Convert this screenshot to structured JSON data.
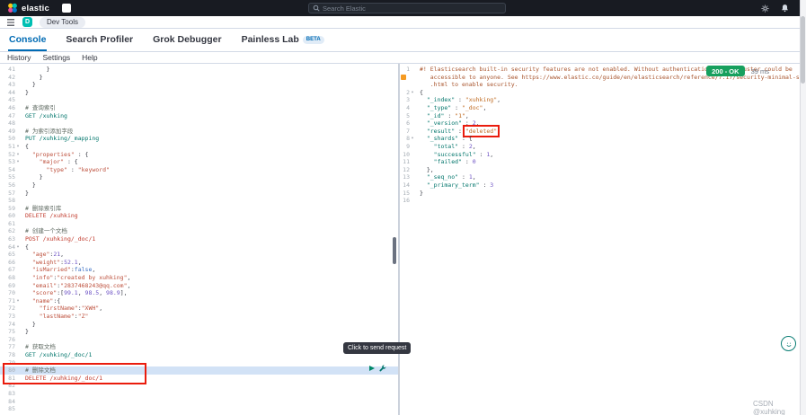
{
  "header": {
    "logo_text": "elastic",
    "search_placeholder": "Search Elastic",
    "right_icons": [
      "settings-icon",
      "notifications-icon"
    ]
  },
  "breadcrumb_bar": {
    "space_initial": "D",
    "breadcrumb": "Dev Tools"
  },
  "tabs": [
    {
      "label": "Console",
      "active": true
    },
    {
      "label": "Search Profiler",
      "active": false
    },
    {
      "label": "Grok Debugger",
      "active": false
    },
    {
      "label": "Painless Lab",
      "active": false,
      "badge": "BETA"
    }
  ],
  "console_toolbar": [
    "History",
    "Settings",
    "Help"
  ],
  "status": {
    "badge": "200 - OK",
    "time": "39 ms"
  },
  "tooltip": "Click to send request",
  "watermark": "CSDN @xuhking",
  "colors": {
    "header_bg": "#181b22",
    "accent_blue": "#006bb4",
    "success_badge": "#17a05e",
    "annotation_red": "#ea1c0d",
    "method_get_put": "#00756b",
    "method_post_delete": "#c0392b",
    "space_avatar": "#00bfb3",
    "warning_icon": "#f59b23"
  },
  "editor": {
    "active_line": 80,
    "lines": [
      {
        "n": 41,
        "s": [
          [
            "      }",
            "p"
          ]
        ]
      },
      {
        "n": 42,
        "s": [
          [
            "    }",
            "p"
          ]
        ]
      },
      {
        "n": 43,
        "s": [
          [
            "  }",
            "p"
          ]
        ]
      },
      {
        "n": 44,
        "s": [
          [
            "}",
            "p"
          ]
        ]
      },
      {
        "n": 45,
        "s": []
      },
      {
        "n": 46,
        "s": [
          [
            "# 查询索引",
            "c"
          ]
        ]
      },
      {
        "n": 47,
        "s": [
          [
            "GET /xuhking",
            "mg"
          ]
        ]
      },
      {
        "n": 48,
        "s": []
      },
      {
        "n": 49,
        "s": [
          [
            "# 为索引添加字段",
            "c"
          ]
        ]
      },
      {
        "n": 50,
        "s": [
          [
            "PUT /xuhking/_mapping",
            "mg"
          ]
        ]
      },
      {
        "n": 51,
        "f": 1,
        "s": [
          [
            "{",
            "p"
          ]
        ]
      },
      {
        "n": 52,
        "f": 1,
        "s": [
          [
            "  ",
            "p"
          ],
          [
            "\"properties\"",
            "s"
          ],
          [
            " : {",
            "p"
          ]
        ]
      },
      {
        "n": 53,
        "f": 1,
        "s": [
          [
            "    ",
            "p"
          ],
          [
            "\"major\"",
            "s"
          ],
          [
            " : {",
            "p"
          ]
        ]
      },
      {
        "n": 54,
        "s": [
          [
            "      ",
            "p"
          ],
          [
            "\"type\"",
            "s"
          ],
          [
            " : ",
            "p"
          ],
          [
            "\"keyword\"",
            "s"
          ]
        ]
      },
      {
        "n": 55,
        "s": [
          [
            "    }",
            "p"
          ]
        ]
      },
      {
        "n": 56,
        "s": [
          [
            "  }",
            "p"
          ]
        ]
      },
      {
        "n": 57,
        "s": [
          [
            "}",
            "p"
          ]
        ]
      },
      {
        "n": 58,
        "s": []
      },
      {
        "n": 59,
        "s": [
          [
            "# 删除索引库",
            "c"
          ]
        ]
      },
      {
        "n": 60,
        "s": [
          [
            "DELETE /xuhking",
            "mr"
          ]
        ]
      },
      {
        "n": 61,
        "s": []
      },
      {
        "n": 62,
        "s": [
          [
            "# 创建一个文档",
            "c"
          ]
        ]
      },
      {
        "n": 63,
        "s": [
          [
            "POST /xuhking/_doc/1",
            "mr"
          ]
        ]
      },
      {
        "n": 64,
        "f": 1,
        "s": [
          [
            "{",
            "p"
          ]
        ]
      },
      {
        "n": 65,
        "s": [
          [
            "  ",
            "p"
          ],
          [
            "\"age\"",
            "s"
          ],
          [
            ":",
            "p"
          ],
          [
            "21",
            "n"
          ],
          [
            ",",
            "p"
          ]
        ]
      },
      {
        "n": 66,
        "s": [
          [
            "  ",
            "p"
          ],
          [
            "\"weight\"",
            "s"
          ],
          [
            ":",
            "p"
          ],
          [
            "52.1",
            "n"
          ],
          [
            ",",
            "p"
          ]
        ]
      },
      {
        "n": 67,
        "s": [
          [
            "  ",
            "p"
          ],
          [
            "\"isMarried\"",
            "s"
          ],
          [
            ":",
            "p"
          ],
          [
            "false",
            "b"
          ],
          [
            ",",
            "p"
          ]
        ]
      },
      {
        "n": 68,
        "s": [
          [
            "  ",
            "p"
          ],
          [
            "\"info\"",
            "s"
          ],
          [
            ":",
            "p"
          ],
          [
            "\"created by xuhking\"",
            "s"
          ],
          [
            ",",
            "p"
          ]
        ]
      },
      {
        "n": 69,
        "s": [
          [
            "  ",
            "p"
          ],
          [
            "\"email\"",
            "s"
          ],
          [
            ":",
            "p"
          ],
          [
            "\"2837468243@qq.com\"",
            "s"
          ],
          [
            ",",
            "p"
          ]
        ]
      },
      {
        "n": 70,
        "s": [
          [
            "  ",
            "p"
          ],
          [
            "\"score\"",
            "s"
          ],
          [
            ":[",
            "p"
          ],
          [
            "99.1",
            "n"
          ],
          [
            ", ",
            "p"
          ],
          [
            "98.5",
            "n"
          ],
          [
            ", ",
            "p"
          ],
          [
            "98.9",
            "n"
          ],
          [
            "],",
            "p"
          ]
        ]
      },
      {
        "n": 71,
        "f": 1,
        "s": [
          [
            "  ",
            "p"
          ],
          [
            "\"name\"",
            "s"
          ],
          [
            ":{",
            "p"
          ]
        ]
      },
      {
        "n": 72,
        "s": [
          [
            "    ",
            "p"
          ],
          [
            "\"firstName\"",
            "s"
          ],
          [
            ":",
            "p"
          ],
          [
            "\"XWH\"",
            "s"
          ],
          [
            ",",
            "p"
          ]
        ]
      },
      {
        "n": 73,
        "s": [
          [
            "    ",
            "p"
          ],
          [
            "\"lastName\"",
            "s"
          ],
          [
            ":",
            "p"
          ],
          [
            "\"Z\"",
            "s"
          ]
        ]
      },
      {
        "n": 74,
        "s": [
          [
            "  }",
            "p"
          ]
        ]
      },
      {
        "n": 75,
        "s": [
          [
            "}",
            "p"
          ]
        ]
      },
      {
        "n": 76,
        "s": []
      },
      {
        "n": 77,
        "s": [
          [
            "# 获取文档",
            "c"
          ]
        ]
      },
      {
        "n": 78,
        "s": [
          [
            "GET /xuhking/_doc/1",
            "mg"
          ]
        ]
      },
      {
        "n": 79,
        "s": []
      },
      {
        "n": 80,
        "s": [
          [
            "# 删除文档",
            "c"
          ]
        ]
      },
      {
        "n": 81,
        "s": [
          [
            "DELETE /xuhking/_doc/1",
            "mr"
          ]
        ]
      },
      {
        "n": 82,
        "s": []
      },
      {
        "n": 83,
        "s": []
      },
      {
        "n": 84,
        "s": []
      },
      {
        "n": 85,
        "s": []
      }
    ]
  },
  "response": {
    "lines": [
      {
        "n": 1,
        "s": [
          [
            "#! Elasticsearch built-in security features are not enabled. Without authentication, your cluster could be",
            "w"
          ]
        ]
      },
      {
        "n": "",
        "warn": 1,
        "s": [
          [
            "   accessible to anyone. See https://www.elastic.co/guide/en/elasticsearch/reference/7.17/security-minimal-setup",
            "w"
          ]
        ]
      },
      {
        "n": "",
        "s": [
          [
            "   .html to enable security.",
            "w"
          ]
        ]
      },
      {
        "n": 2,
        "f": 1,
        "s": [
          [
            "{",
            "p"
          ]
        ]
      },
      {
        "n": 3,
        "s": [
          [
            "  ",
            "p"
          ],
          [
            "\"_index\"",
            "k"
          ],
          [
            " : ",
            "p"
          ],
          [
            "\"xuhking\"",
            "v"
          ],
          [
            ",",
            "p"
          ]
        ]
      },
      {
        "n": 4,
        "s": [
          [
            "  ",
            "p"
          ],
          [
            "\"_type\"",
            "k"
          ],
          [
            " : ",
            "p"
          ],
          [
            "\"_doc\"",
            "v"
          ],
          [
            ",",
            "p"
          ]
        ]
      },
      {
        "n": 5,
        "s": [
          [
            "  ",
            "p"
          ],
          [
            "\"_id\"",
            "k"
          ],
          [
            " : ",
            "p"
          ],
          [
            "\"1\"",
            "v"
          ],
          [
            ",",
            "p"
          ]
        ]
      },
      {
        "n": 6,
        "s": [
          [
            "  ",
            "p"
          ],
          [
            "\"_version\"",
            "k"
          ],
          [
            " : ",
            "p"
          ],
          [
            "2",
            "n"
          ],
          [
            ",",
            "p"
          ]
        ]
      },
      {
        "n": 7,
        "s": [
          [
            "  ",
            "p"
          ],
          [
            "\"result\"",
            "k"
          ],
          [
            " : ",
            "p"
          ],
          [
            "\"deleted\"",
            "v boxed"
          ],
          [
            ",",
            "p"
          ]
        ]
      },
      {
        "n": 8,
        "f": 1,
        "s": [
          [
            "  ",
            "p"
          ],
          [
            "\"_shards\"",
            "k"
          ],
          [
            " : {",
            "p"
          ]
        ]
      },
      {
        "n": 9,
        "s": [
          [
            "    ",
            "p"
          ],
          [
            "\"total\"",
            "k"
          ],
          [
            " : ",
            "p"
          ],
          [
            "2",
            "n"
          ],
          [
            ",",
            "p"
          ]
        ]
      },
      {
        "n": 10,
        "s": [
          [
            "    ",
            "p"
          ],
          [
            "\"successful\"",
            "k"
          ],
          [
            " : ",
            "p"
          ],
          [
            "1",
            "n"
          ],
          [
            ",",
            "p"
          ]
        ]
      },
      {
        "n": 11,
        "s": [
          [
            "    ",
            "p"
          ],
          [
            "\"failed\"",
            "k"
          ],
          [
            " : ",
            "p"
          ],
          [
            "0",
            "n"
          ]
        ]
      },
      {
        "n": 12,
        "s": [
          [
            "  },",
            "p"
          ]
        ]
      },
      {
        "n": 13,
        "s": [
          [
            "  ",
            "p"
          ],
          [
            "\"_seq_no\"",
            "k"
          ],
          [
            " : ",
            "p"
          ],
          [
            "1",
            "n"
          ],
          [
            ",",
            "p"
          ]
        ]
      },
      {
        "n": 14,
        "s": [
          [
            "  ",
            "p"
          ],
          [
            "\"_primary_term\"",
            "k"
          ],
          [
            " : ",
            "p"
          ],
          [
            "3",
            "n"
          ]
        ]
      },
      {
        "n": 15,
        "s": [
          [
            "}",
            "p"
          ]
        ]
      },
      {
        "n": 16,
        "s": []
      }
    ]
  }
}
